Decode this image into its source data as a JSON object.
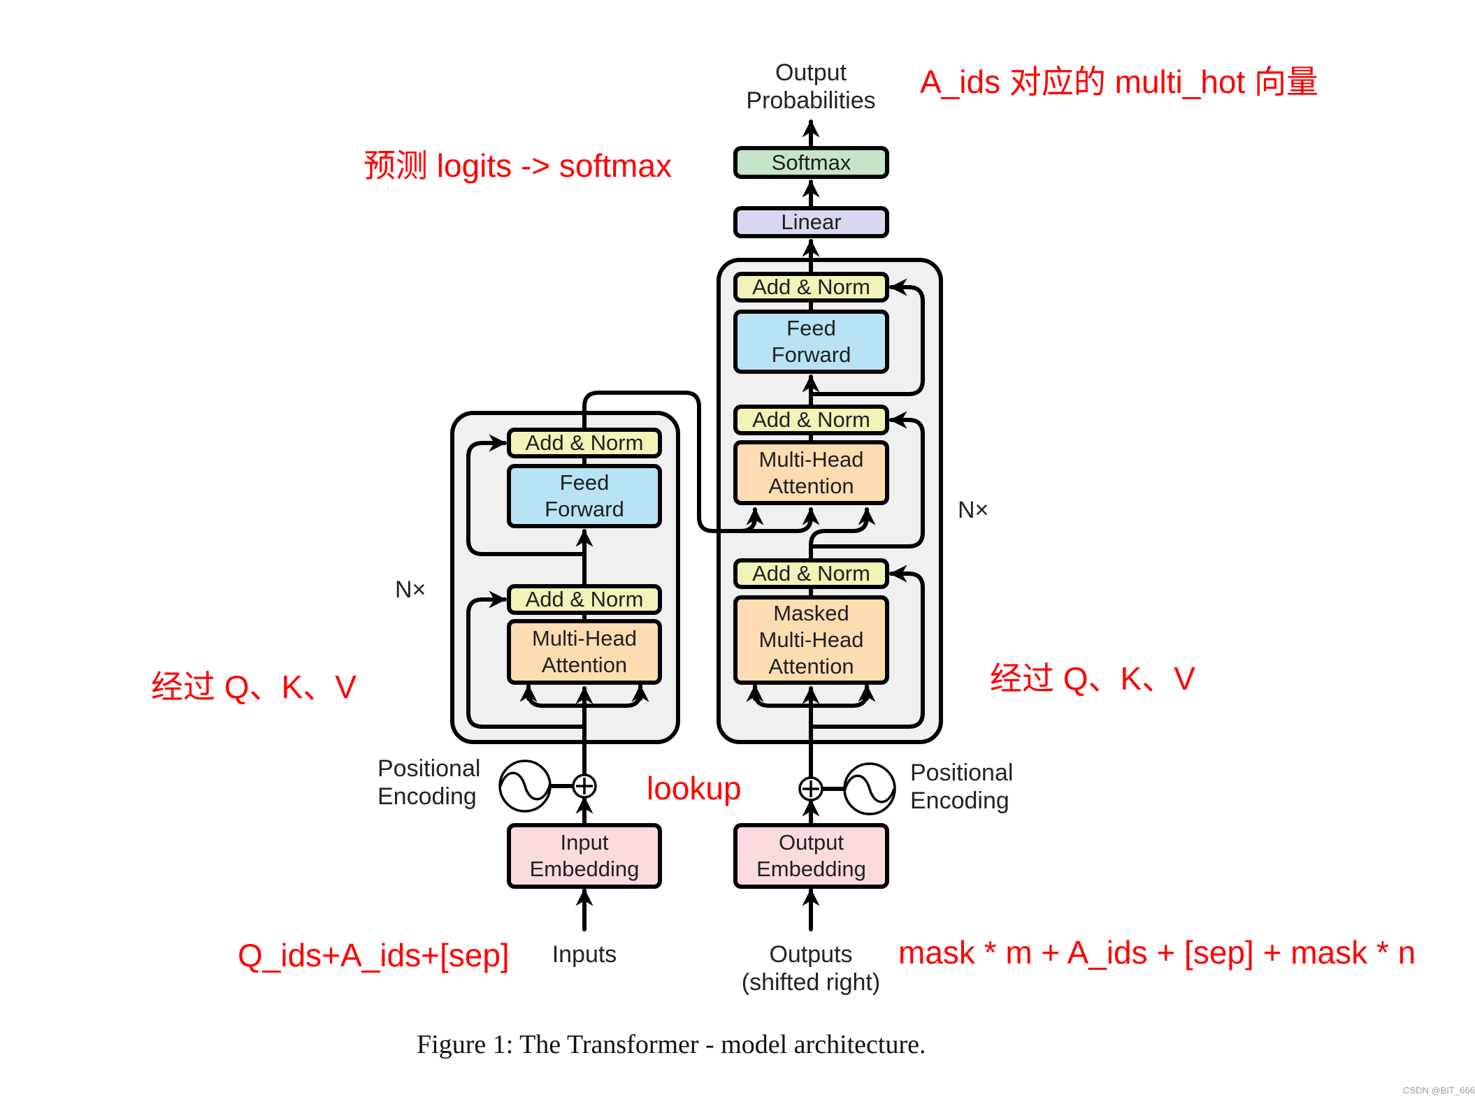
{
  "colors": {
    "softmax": "#c6e5c8",
    "linear": "#d6d9ee",
    "add_norm": "#f2f3b8",
    "feed_forward": "#b7e3f4",
    "attention": "#fddcb1",
    "embedding": "#fbdadd",
    "block_bg": "#f0f0f0",
    "annotation": "#ff0000"
  },
  "decoder": {
    "output_probabilities": [
      "Output",
      "Probabilities"
    ],
    "softmax": "Softmax",
    "linear": "Linear",
    "add_norm_1": "Add & Norm",
    "feed_forward": [
      "Feed",
      "Forward"
    ],
    "add_norm_2": "Add & Norm",
    "mha": [
      "Multi-Head",
      "Attention"
    ],
    "add_norm_3": "Add & Norm",
    "masked_mha": [
      "Masked",
      "Multi-Head",
      "Attention"
    ],
    "nx": "N×",
    "positional_encoding": [
      "Positional",
      "Encoding"
    ],
    "output_embedding": [
      "Output",
      "Embedding"
    ],
    "outputs": [
      "Outputs",
      "(shifted right)"
    ]
  },
  "encoder": {
    "add_norm_1": "Add & Norm",
    "feed_forward": [
      "Feed",
      "Forward"
    ],
    "add_norm_2": "Add & Norm",
    "mha": [
      "Multi-Head",
      "Attention"
    ],
    "nx": "N×",
    "positional_encoding": [
      "Positional",
      "Encoding"
    ],
    "input_embedding": [
      "Input",
      "Embedding"
    ],
    "inputs": "Inputs"
  },
  "annotations": {
    "output_target": "A_ids 对应的 multi_hot 向量",
    "predict": "预测 logits -> softmax",
    "qkv_left": "经过 Q、K、V",
    "qkv_right": "经过 Q、K、V",
    "lookup": "lookup",
    "input_ids": "Q_ids+A_ids+[sep]",
    "output_ids": "mask * m + A_ids + [sep] + mask * n"
  },
  "caption": "Figure 1: The Transformer - model architecture.",
  "watermark": "CSDN @BIT_666"
}
